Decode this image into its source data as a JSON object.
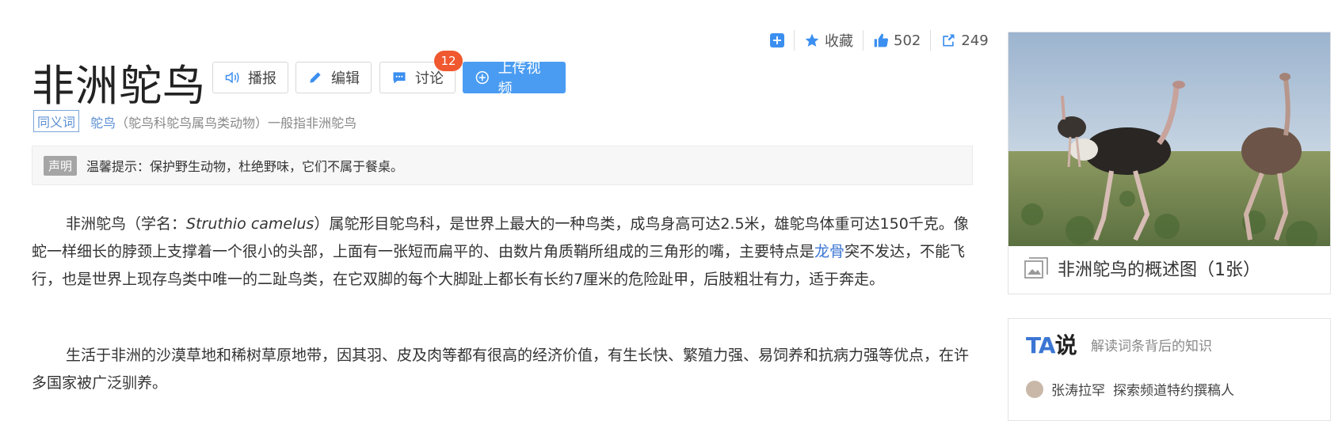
{
  "meta": {
    "add_icon": "plus-square-icon",
    "collect_label": "收藏",
    "like_count": "502",
    "share_count": "249",
    "accent": "#3b8ff0"
  },
  "header": {
    "title": "非洲鸵鸟",
    "buttons": {
      "broadcast": "播报",
      "edit": "编辑",
      "discuss": "讨论",
      "discuss_badge": "12",
      "upload_video": "上传视频"
    }
  },
  "synonym": {
    "tag": "同义词",
    "link": "鸵鸟",
    "text": "（鸵鸟科鸵鸟属鸟类动物）一般指非洲鸵鸟"
  },
  "notice": {
    "tag": "声明",
    "text": "温馨提示：保护野生动物，杜绝野味，它们不属于餐桌。"
  },
  "content": {
    "p1_a": "非洲鸵鸟（学名：",
    "p1_latin": "Struthio camelus",
    "p1_b": "）属鸵形目鸵鸟科，是世界上最大的一种鸟类，成鸟身高可达2.5米，雄鸵鸟体重可达150千克。像蛇一样细长的脖颈上支撑着一个很小的头部，上面有一张短而扁平的、由数片角质鞘所组成的三角形的嘴，主要特点是",
    "p1_link": "龙骨",
    "p1_c": "突不发达，不能飞行，也是世界上现存鸟类中唯一的二趾鸟类，在它双脚的每个大脚趾上都长有长约7厘米的危险趾甲，后肢粗壮有力，适于奔走。",
    "p2": "生活于非洲的沙漠草地和稀树草原地带，因其羽、皮及肉等都有很高的经济价值，有生长快、繁殖力强、易饲养和抗病力强等优点，在许多国家被广泛驯养。"
  },
  "sidebar": {
    "image_caption": "非洲鸵鸟的概述图（1张）",
    "ta_logo_a": "TA",
    "ta_logo_b": "说",
    "ta_subtitle": "解读词条背后的知识",
    "ta_author": "张涛拉罕",
    "ta_author_title": "探索频道特约撰稿人"
  }
}
